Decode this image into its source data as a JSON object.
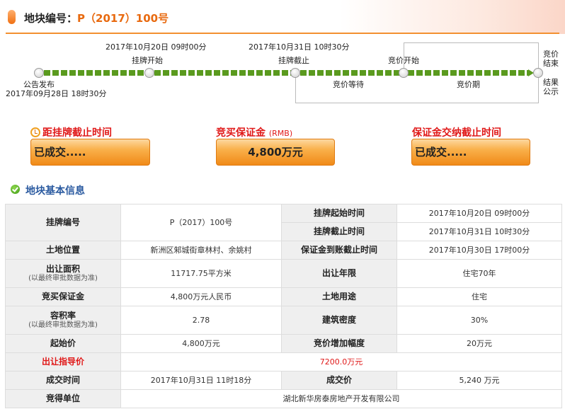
{
  "header": {
    "label": "地块编号：",
    "code": "P（2017）100号"
  },
  "timeline": {
    "publish_label": "公告发布",
    "publish_time": "2017年09月28日  18时30分",
    "listing_start_label": "挂牌开始",
    "listing_start_time": "2017年10月20日  09时00分",
    "listing_end_label": "挂牌截止",
    "listing_end_time": "2017年10月31日  10时30分",
    "bid_start_label": "竞价开始",
    "waiting_label": "竞价等待",
    "bid_period_label": "竞价期",
    "bid_end_label_1": "竞价",
    "bid_end_label_2": "结束",
    "result_label_1": "结果",
    "result_label_2": "公示"
  },
  "cards": {
    "countdown": {
      "title": "距挂牌截止时间",
      "value": "已成交....."
    },
    "deposit": {
      "title": "竞买保证金",
      "unit": "(RMB)",
      "value": "4,800万元"
    },
    "deposit_deadline": {
      "title": "保证金交纳截止时间",
      "value": "已成交....."
    }
  },
  "section": {
    "title": "地块基本信息"
  },
  "table": {
    "listing_no_label": "挂牌编号",
    "listing_no": "P（2017）100号",
    "listing_start_label": "挂牌起始时间",
    "listing_start": "2017年10月20日  09时00分",
    "listing_end_label": "挂牌截止时间",
    "listing_end": "2017年10月31日  10时30分",
    "location_label": "土地位置",
    "location": "新洲区邾城街章林村、余姚村",
    "deposit_arrival_label": "保证金到账截止时间",
    "deposit_arrival": "2017年10月30日  17时00分",
    "area_label": "出让面积",
    "area_note": "(以最终审批数据为准)",
    "area": "11717.75平方米",
    "term_label": "出让年限",
    "term": "住宅70年",
    "bid_deposit_label": "竞买保证金",
    "bid_deposit": "4,800万元人民币",
    "use_label": "土地用途",
    "use": "住宅",
    "far_label": "容积率",
    "far_note": "(以最终审批数据为准)",
    "far": "2.78",
    "density_label": "建筑密度",
    "density": "30%",
    "start_price_label": "起始价",
    "start_price": "4,800万元",
    "increment_label": "竞价增加幅度",
    "increment": "20万元",
    "guide_price_label": "出让指导价",
    "guide_price": "7200.0万元",
    "deal_time_label": "成交时间",
    "deal_time": "2017年10月31日  11时18分",
    "deal_price_label": "成交价",
    "deal_price": "5,240 万元",
    "winner_label": "竞得单位",
    "winner": "湖北新华房泰房地产开发有限公司"
  }
}
